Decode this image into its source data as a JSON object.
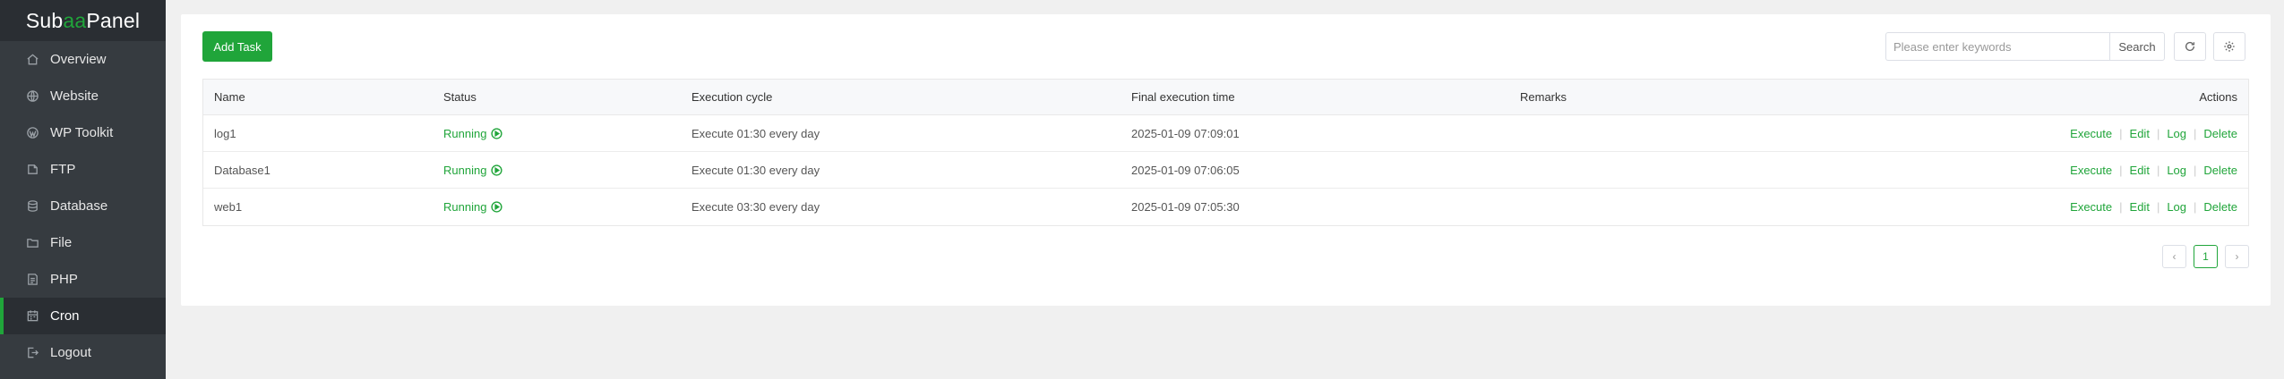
{
  "brand": {
    "prefix": "Sub ",
    "accent": "aa",
    "suffix": "Panel"
  },
  "sidebar": {
    "items": [
      {
        "label": "Overview",
        "icon": "home-icon"
      },
      {
        "label": "Website",
        "icon": "globe-icon"
      },
      {
        "label": "WP Toolkit",
        "icon": "wordpress-icon"
      },
      {
        "label": "FTP",
        "icon": "ftp-icon"
      },
      {
        "label": "Database",
        "icon": "database-icon"
      },
      {
        "label": "File",
        "icon": "folder-icon"
      },
      {
        "label": "PHP",
        "icon": "php-icon"
      },
      {
        "label": "Cron",
        "icon": "calendar-icon"
      },
      {
        "label": "Logout",
        "icon": "logout-icon"
      }
    ],
    "active": "Cron"
  },
  "toolbar": {
    "add_label": "Add Task",
    "search_placeholder": "Please enter keywords",
    "search_label": "Search"
  },
  "table": {
    "headers": {
      "name": "Name",
      "status": "Status",
      "cycle": "Execution cycle",
      "last": "Final execution time",
      "remarks": "Remarks",
      "actions": "Actions"
    },
    "rows": [
      {
        "name": "log1",
        "status": "Running",
        "cycle": "Execute 01:30 every day",
        "last": "2025-01-09 07:09:01",
        "remarks": ""
      },
      {
        "name": "Database1",
        "status": "Running",
        "cycle": "Execute 01:30 every day",
        "last": "2025-01-09 07:06:05",
        "remarks": ""
      },
      {
        "name": "web1",
        "status": "Running",
        "cycle": "Execute 03:30 every day",
        "last": "2025-01-09 07:05:30",
        "remarks": ""
      }
    ],
    "action_labels": {
      "execute": "Execute",
      "edit": "Edit",
      "log": "Log",
      "delete": "Delete"
    }
  },
  "pagination": {
    "prev": "‹",
    "current": "1",
    "next": "›"
  },
  "colors": {
    "accent": "#20a53a",
    "sidebar": "#363b40"
  }
}
